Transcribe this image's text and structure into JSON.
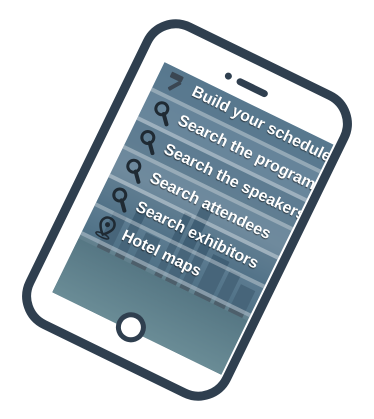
{
  "menu": {
    "items": [
      {
        "label": "Build your schedule",
        "icon": "hammer-icon"
      },
      {
        "label": "Search the program",
        "icon": "magnifier-icon"
      },
      {
        "label": "Search the speakers",
        "icon": "magnifier-icon"
      },
      {
        "label": "Search attendees",
        "icon": "magnifier-icon"
      },
      {
        "label": "Search exhibitors",
        "icon": "magnifier-icon"
      },
      {
        "label": "Hotel maps",
        "icon": "map-pin-icon"
      }
    ]
  },
  "colors": {
    "phone_frame": "#2f3f4f",
    "menu_band": "#3c5f78",
    "menu_text": "#ffffff"
  }
}
